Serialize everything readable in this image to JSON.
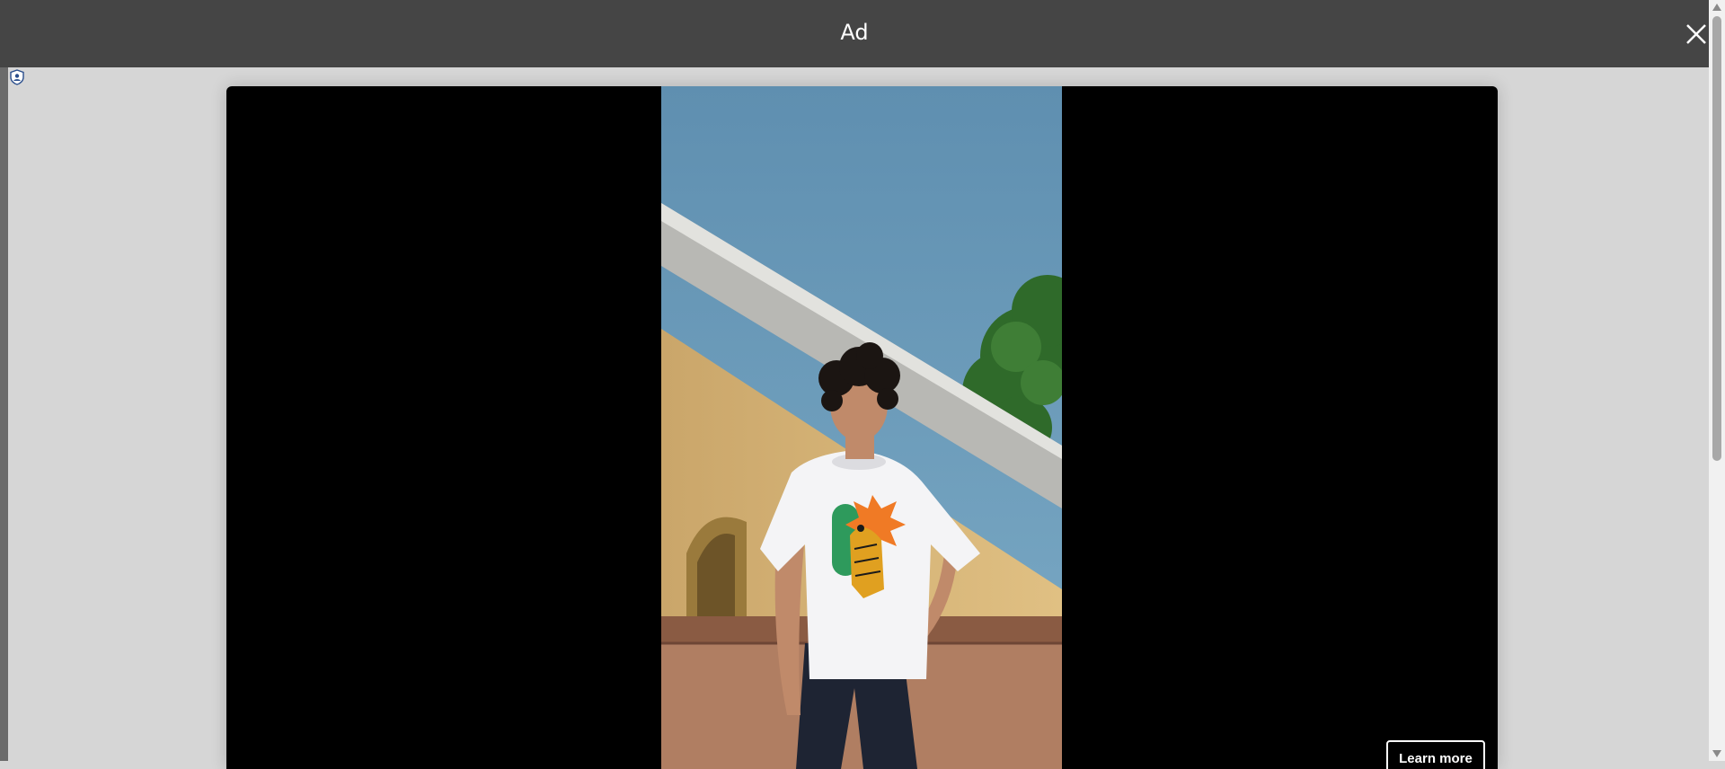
{
  "header": {
    "title": "Ad",
    "close_icon": "close-icon"
  },
  "badge": {
    "icon": "shield-user-icon"
  },
  "ad": {
    "image_description_icon": "ad-photo",
    "cta_label": "Learn more"
  },
  "scrollbar": {
    "up_icon": "arrow-up-icon",
    "down_icon": "arrow-down-icon"
  },
  "colors": {
    "header_bg": "#454545",
    "page_bg": "#d6d6d6",
    "ad_bg": "#000000",
    "sky": "#6b9cbd",
    "wall": "#d8b978",
    "shirt": "#f4f4f6"
  }
}
